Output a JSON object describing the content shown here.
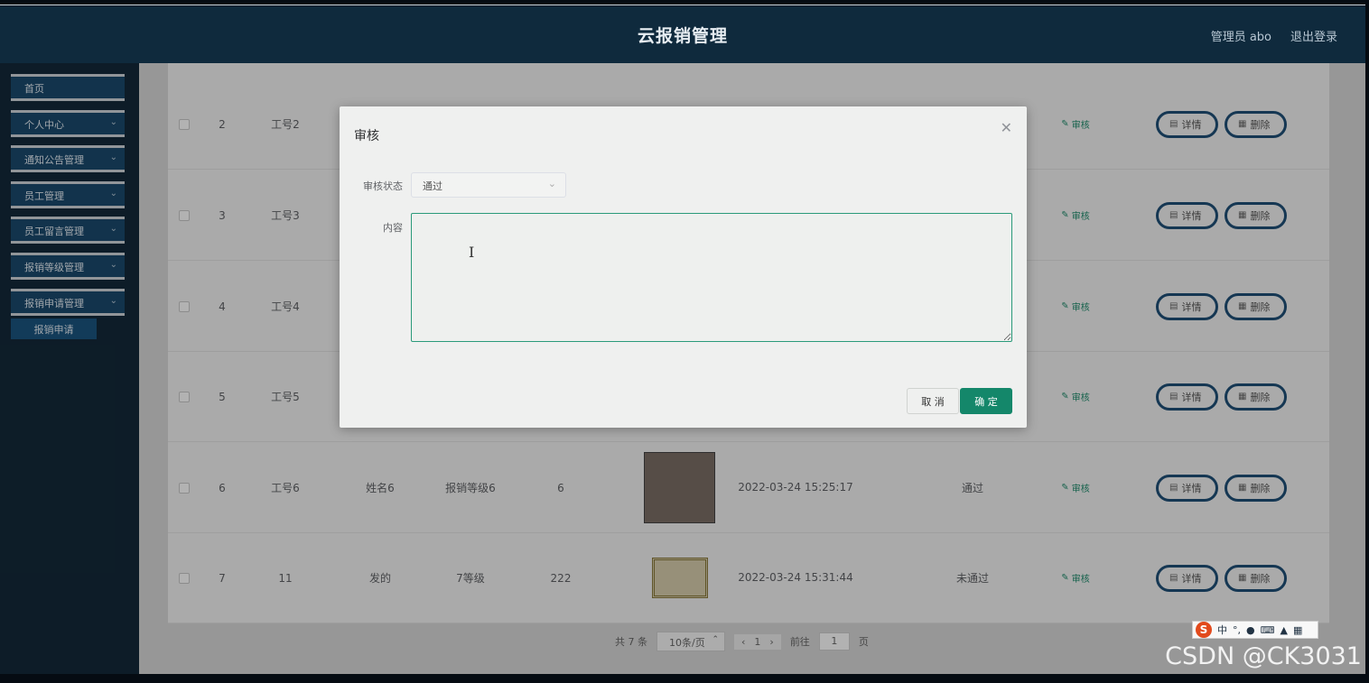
{
  "header": {
    "title": "云报销管理",
    "user": "管理员 abo",
    "logout": "退出登录"
  },
  "sidebar": {
    "items": [
      {
        "label": "首页"
      },
      {
        "label": "个人中心"
      },
      {
        "label": "通知公告管理"
      },
      {
        "label": "员工管理"
      },
      {
        "label": "员工留言管理"
      },
      {
        "label": "报销等级管理"
      },
      {
        "label": "报销申请管理"
      }
    ],
    "submenu": {
      "label": "报销申请"
    }
  },
  "table": {
    "rows": [
      {
        "idx": "2",
        "no": "工号2",
        "name": "",
        "level": "",
        "amount": "",
        "date": "",
        "status": "",
        "audit": "审核"
      },
      {
        "idx": "3",
        "no": "工号3",
        "name": "",
        "level": "",
        "amount": "",
        "date": "",
        "status": "",
        "audit": "审核"
      },
      {
        "idx": "4",
        "no": "工号4",
        "name": "",
        "level": "",
        "amount": "",
        "date": "",
        "status": "",
        "audit": "审核"
      },
      {
        "idx": "5",
        "no": "工号5",
        "name": "",
        "level": "",
        "amount": "",
        "date": "",
        "status": "",
        "audit": "审核"
      },
      {
        "idx": "6",
        "no": "工号6",
        "name": "姓名6",
        "level": "报销等级6",
        "amount": "6",
        "date": "2022-03-24 15:25:17",
        "status": "通过",
        "audit": "审核"
      },
      {
        "idx": "7",
        "no": "11",
        "name": "发的",
        "level": "7等级",
        "amount": "222",
        "date": "2022-03-24 15:31:44",
        "status": "未通过",
        "audit": "审核"
      }
    ],
    "detail_label": "详情",
    "delete_label": "删除"
  },
  "pager": {
    "total": "共 7 条",
    "page_size": "10条/页",
    "current": "1",
    "goto_label": "前往",
    "goto_value": "1",
    "page_unit": "页"
  },
  "modal": {
    "title": "审核",
    "status_label": "审核状态",
    "status_value": "通过",
    "content_label": "内容",
    "content_value": "",
    "cancel_label": "取 消",
    "ok_label": "确 定"
  },
  "ime": {
    "logo": "S",
    "lang": "中"
  },
  "watermark": "CSDN @CK3031",
  "colors": {
    "header_bg": "#0f2a3d",
    "sidebar_item": "#1a4a6e",
    "accent": "#14876a",
    "pill_border": "#1f4f77"
  }
}
